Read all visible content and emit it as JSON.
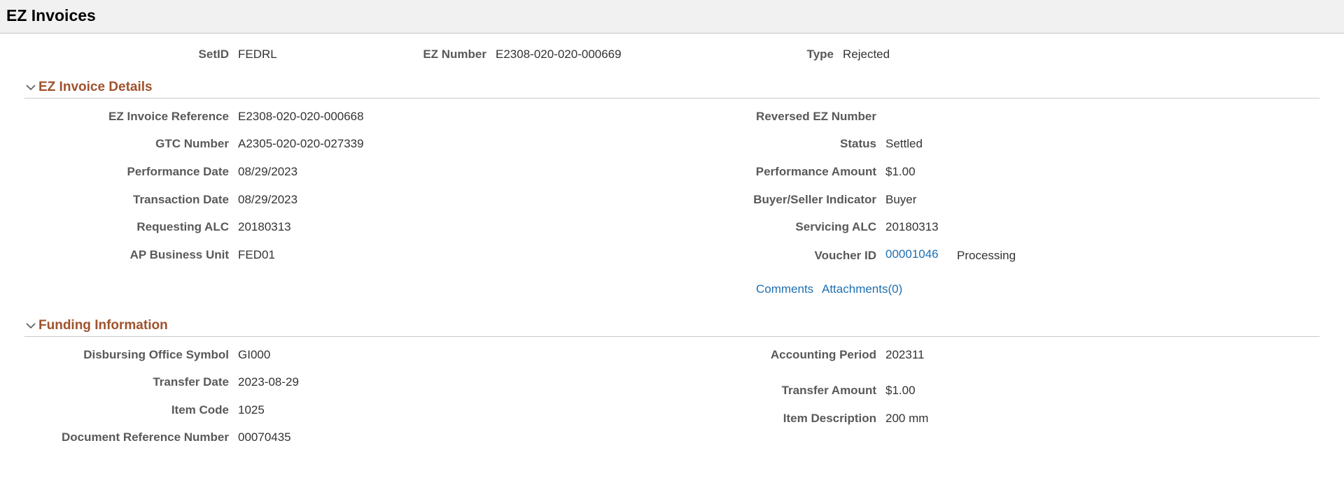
{
  "page": {
    "title": "EZ Invoices"
  },
  "keys": {
    "setid_label": "SetID",
    "setid_value": "FEDRL",
    "eznum_label": "EZ Number",
    "eznum_value": "E2308-020-020-000669",
    "type_label": "Type",
    "type_value": "Rejected"
  },
  "details": {
    "title": "EZ Invoice Details",
    "left": [
      {
        "label": "EZ Invoice Reference",
        "value": "E2308-020-020-000668"
      },
      {
        "label": "GTC Number",
        "value": "A2305-020-020-027339"
      },
      {
        "label": "Performance Date",
        "value": "08/29/2023"
      },
      {
        "label": "Transaction Date",
        "value": "08/29/2023"
      },
      {
        "label": "Requesting ALC",
        "value": "20180313"
      },
      {
        "label": "AP Business Unit",
        "value": "FED01"
      }
    ],
    "right": [
      {
        "label": "Reversed EZ Number",
        "value": ""
      },
      {
        "label": "Status",
        "value": "Settled"
      },
      {
        "label": "Performance Amount",
        "value": "$1.00"
      },
      {
        "label": "Buyer/Seller Indicator",
        "value": "Buyer"
      },
      {
        "label": "Servicing ALC",
        "value": "20180313"
      },
      {
        "label": "Voucher ID",
        "value": "00001046",
        "extra": "Processing"
      }
    ],
    "comments_link": "Comments",
    "attachments_link": "Attachments(0)"
  },
  "funding": {
    "title": "Funding Information",
    "left": [
      {
        "label": "Disbursing Office Symbol",
        "value": "GI000"
      },
      {
        "label": "Transfer Date",
        "value": "2023-08-29"
      },
      {
        "label": "Item Code",
        "value": "1025"
      },
      {
        "label": "Document Reference Number",
        "value": "00070435"
      }
    ],
    "right": [
      {
        "label": "Accounting Period",
        "value": "202311"
      },
      {
        "label": "Transfer Amount",
        "value": "$1.00"
      },
      {
        "label": "Item Description",
        "value": "200 mm"
      }
    ]
  },
  "colors": {
    "section_title": "#a0522d",
    "link": "#1f6fb1",
    "label": "#595959"
  }
}
